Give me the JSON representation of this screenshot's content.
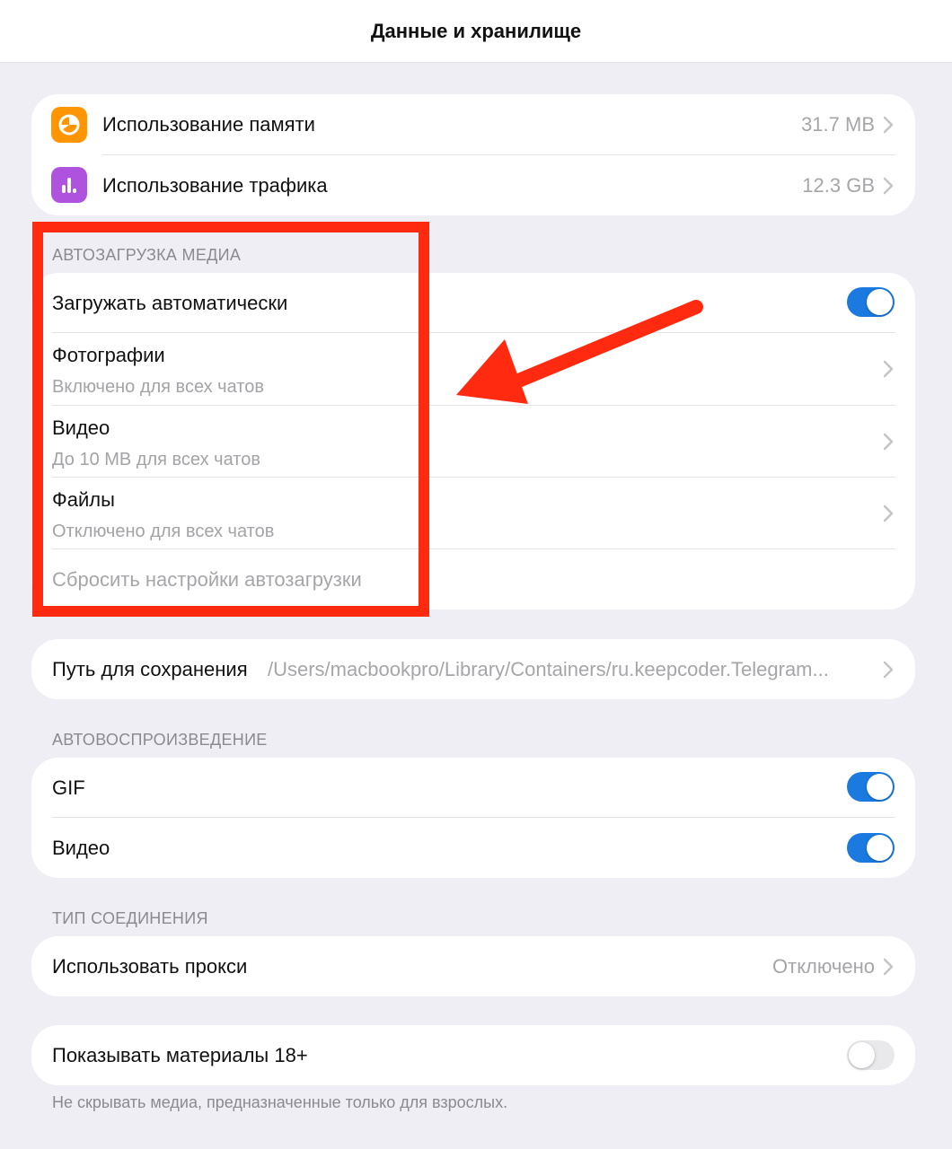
{
  "header": {
    "title": "Данные и хранилище"
  },
  "usage": {
    "memory": {
      "label": "Использование памяти",
      "value": "31.7 MB",
      "icon": "pie-chart-icon",
      "color": "#ff9500"
    },
    "traffic": {
      "label": "Использование трафика",
      "value": "12.3 GB",
      "icon": "bar-chart-icon",
      "color": "#af52de"
    }
  },
  "autodownload": {
    "header": "АВТОЗАГРУЗКА МЕДИА",
    "auto": {
      "label": "Загружать автоматически",
      "enabled": true
    },
    "photos": {
      "label": "Фотографии",
      "sub": "Включено для всех чатов"
    },
    "videos": {
      "label": "Видео",
      "sub": "До 10 MB для всех чатов"
    },
    "files": {
      "label": "Файлы",
      "sub": "Отключено для всех чатов"
    },
    "reset": {
      "label": "Сбросить настройки автозагрузки"
    }
  },
  "save_path": {
    "label": "Путь для сохранения",
    "value": "/Users/macbookpro/Library/Containers/ru.keepcoder.Telegram..."
  },
  "autoplay": {
    "header": "АВТОВОСПРОИЗВЕДЕНИЕ",
    "gif": {
      "label": "GIF",
      "enabled": true
    },
    "video": {
      "label": "Видео",
      "enabled": true
    }
  },
  "connection": {
    "header": "ТИП СОЕДИНЕНИЯ",
    "proxy": {
      "label": "Использовать прокси",
      "value": "Отключено"
    }
  },
  "adult": {
    "label": "Показывать материалы 18+",
    "enabled": false,
    "footnote": "Не скрывать медиа, предназначенные только для взрослых."
  },
  "colors": {
    "toggle_on": "#1a7ae0",
    "annotation": "#ff2a0f"
  }
}
